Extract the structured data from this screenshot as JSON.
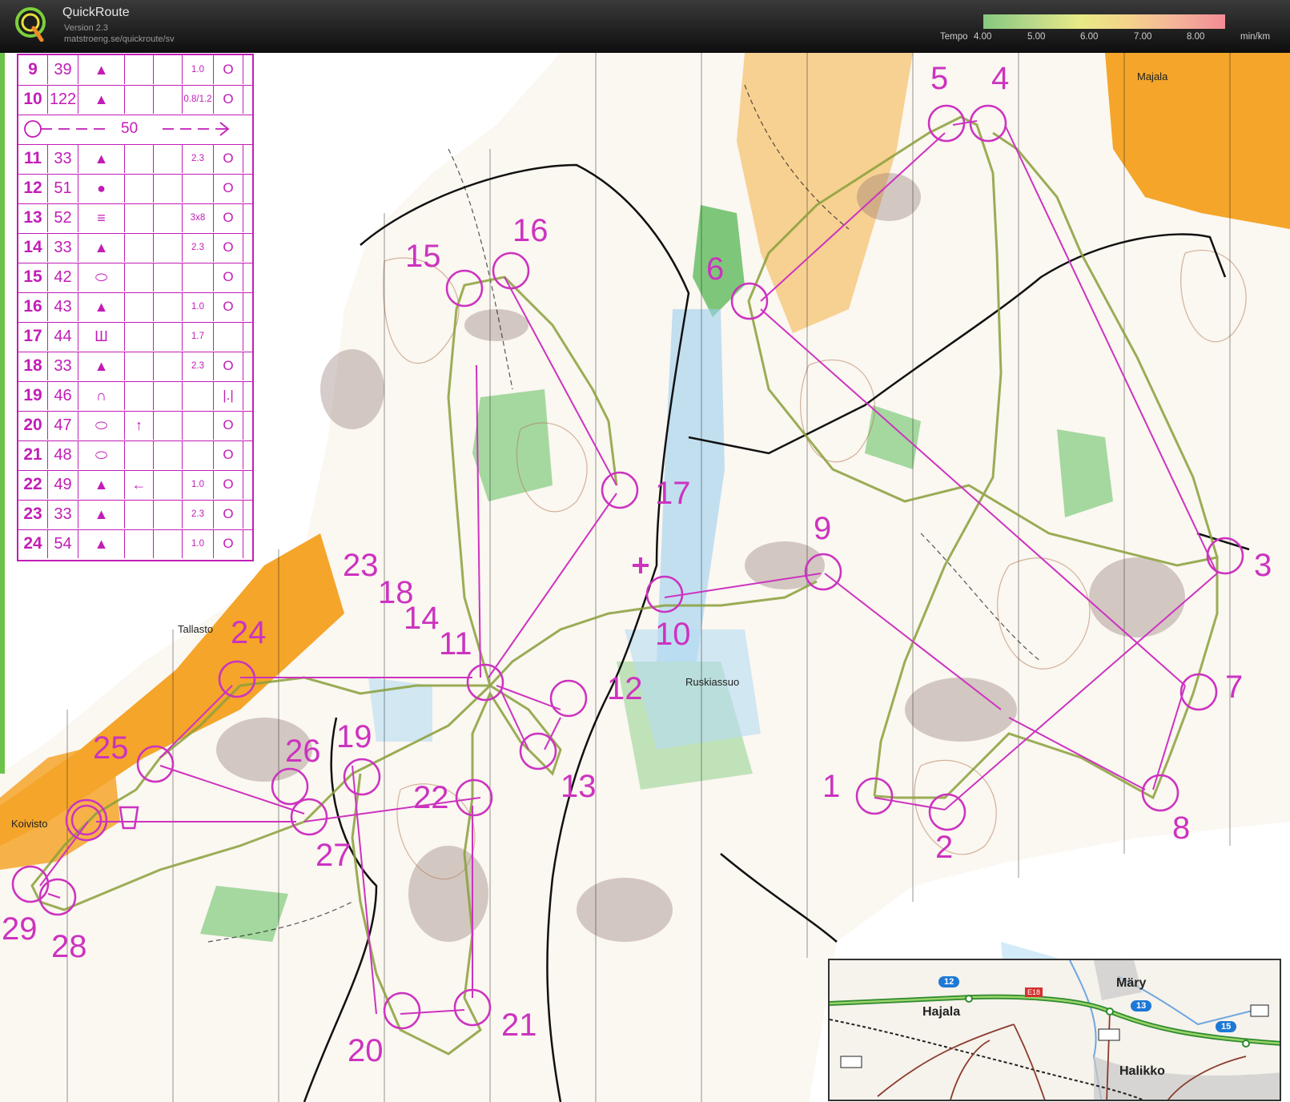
{
  "app": {
    "title": "QuickRoute",
    "version": "Version 2.3",
    "url": "matstroeng.se/quickroute/sv"
  },
  "tempo": {
    "label": "Tempo",
    "unit": "min/km",
    "ticks": [
      "4.00",
      "5.00",
      "6.00",
      "7.00",
      "8.00"
    ]
  },
  "legend": {
    "rows": [
      {
        "num": "9",
        "code": "39",
        "dir": "",
        "feature": "▲",
        "dim": "1.0",
        "pos": "O"
      },
      {
        "num": "10",
        "code": "122",
        "dir": "",
        "feature": "▲",
        "dim": "0.8/1.2",
        "pos": "O"
      },
      {
        "special": "50"
      },
      {
        "num": "11",
        "code": "33",
        "dir": "",
        "feature": "▲",
        "dim": "2.3",
        "pos": "O"
      },
      {
        "num": "12",
        "code": "51",
        "dir": "",
        "feature": "●",
        "dim": "",
        "pos": "O"
      },
      {
        "num": "13",
        "code": "52",
        "dir": "",
        "feature": "≡",
        "dim": "3x8",
        "pos": "O"
      },
      {
        "num": "14",
        "code": "33",
        "dir": "",
        "feature": "▲",
        "dim": "2.3",
        "pos": "O"
      },
      {
        "num": "15",
        "code": "42",
        "dir": "",
        "feature": "⬭",
        "dim": "",
        "pos": "O"
      },
      {
        "num": "16",
        "code": "43",
        "dir": "",
        "feature": "▲",
        "dim": "1.0",
        "pos": "O"
      },
      {
        "num": "17",
        "code": "44",
        "dir": "",
        "feature": "Ш",
        "dim": "1.7",
        "pos": ""
      },
      {
        "num": "18",
        "code": "33",
        "dir": "",
        "feature": "▲",
        "dim": "2.3",
        "pos": "O"
      },
      {
        "num": "19",
        "code": "46",
        "dir": "",
        "feature": "∩",
        "dim": "",
        "pos": "|.|"
      },
      {
        "num": "20",
        "code": "47",
        "dir": "↑",
        "feature": "⬭",
        "dim": "",
        "pos": "O"
      },
      {
        "num": "21",
        "code": "48",
        "dir": "",
        "feature": "⬭",
        "dim": "",
        "pos": "O"
      },
      {
        "num": "22",
        "code": "49",
        "dir": "←",
        "feature": "▲",
        "dim": "1.0",
        "pos": "O"
      },
      {
        "num": "23",
        "code": "33",
        "dir": "",
        "feature": "▲",
        "dim": "2.3",
        "pos": "O"
      },
      {
        "num": "24",
        "code": "54",
        "dir": "",
        "feature": "▲",
        "dim": "1.0",
        "pos": "O"
      }
    ]
  },
  "controls": [
    "1",
    "2",
    "3",
    "4",
    "5",
    "6",
    "7",
    "8",
    "9",
    "10",
    "11",
    "12",
    "13",
    "14",
    "15",
    "16",
    "17",
    "18",
    "19",
    "20",
    "21",
    "22",
    "23",
    "24",
    "25",
    "26",
    "27",
    "28",
    "29"
  ],
  "places": {
    "majala": "Majala",
    "tallasto": "Tallasto",
    "ruskiassuo": "Ruskiassuo",
    "koivisto": "Koivisto"
  },
  "inset": {
    "towns": [
      "Märy",
      "Hajala",
      "Halikko"
    ],
    "roads": [
      "12",
      "13",
      "15"
    ],
    "euro_road": "E18"
  },
  "colors": {
    "course": "#cc33bf",
    "route": "#7fa33a",
    "forest_green": "#7ec77a",
    "open_yellow": "#f4a52a",
    "water": "#6fb7e8"
  }
}
